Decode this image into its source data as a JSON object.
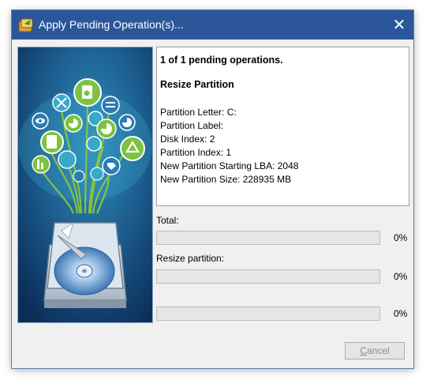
{
  "window": {
    "title": "Apply Pending Operation(s)...",
    "close_glyph": "✕",
    "accent_color": "#2b579a"
  },
  "info": {
    "summary": "1 of 1 pending operations.",
    "operation": "Resize Partition",
    "details": [
      "Partition Letter: C:",
      "Partition Label:",
      "Disk Index: 2",
      "Partition Index: 1",
      "New Partition Starting LBA: 2048",
      "New Partition Size: 228935 MB"
    ]
  },
  "progress": [
    {
      "label": "Total:",
      "percent_text": "0%",
      "value": 0
    },
    {
      "label": "Resize partition:",
      "percent_text": "0%",
      "value": 0
    },
    {
      "label": "",
      "percent_text": "0%",
      "value": 0
    }
  ],
  "buttons": {
    "cancel_first": "C",
    "cancel_rest": "ancel"
  },
  "icons": {
    "app": "app-icon",
    "close": "close-icon",
    "art": "disk-data-tree-illustration"
  }
}
